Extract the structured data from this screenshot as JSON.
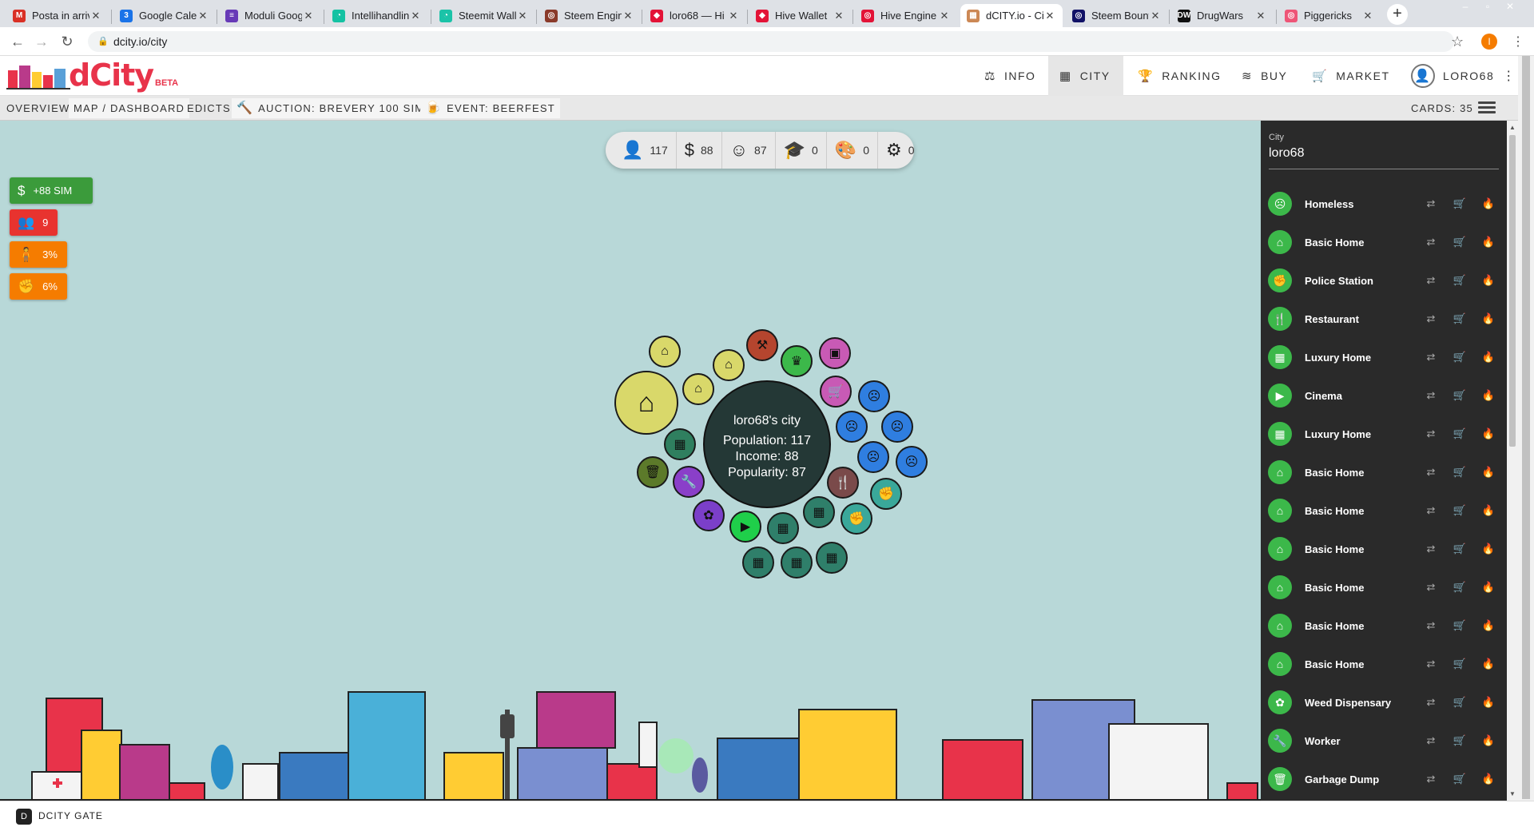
{
  "browser": {
    "tabs": [
      {
        "title": "Posta in arriv",
        "icon": "gmail-icon",
        "fav": "M",
        "color": "#d93025"
      },
      {
        "title": "Google Calen",
        "icon": "calendar-icon",
        "fav": "3",
        "color": "#1a73e8"
      },
      {
        "title": "Moduli Goog",
        "icon": "forms-icon",
        "fav": "≡",
        "color": "#673ab7"
      },
      {
        "title": "Intellihandlin",
        "icon": "intellihandling-icon",
        "fav": "◔",
        "color": "#14c2a3"
      },
      {
        "title": "Steemit Wall",
        "icon": "steemit-icon",
        "fav": "◔",
        "color": "#1bc3a8"
      },
      {
        "title": "Steem Engin",
        "icon": "steem-engine-icon",
        "fav": "◎",
        "color": "#8a3a2a"
      },
      {
        "title": "loro68 — Hi",
        "icon": "hive-icon",
        "fav": "◆",
        "color": "#e31337"
      },
      {
        "title": "Hive Wallet",
        "icon": "hive-wallet-icon",
        "fav": "◆",
        "color": "#e31337"
      },
      {
        "title": "Hive Engine",
        "icon": "hive-engine-icon",
        "fav": "◎",
        "color": "#e31337"
      },
      {
        "title": "dCITY.io - Ci",
        "icon": "dcity-icon",
        "fav": "▦",
        "color": "#c85"
      },
      {
        "title": "Steem Bount",
        "icon": "steem-bounty-icon",
        "fav": "◎",
        "color": "#116"
      },
      {
        "title": "DrugWars",
        "icon": "drugwars-icon",
        "fav": "DW",
        "color": "#111"
      },
      {
        "title": "Piggericks",
        "icon": "piggericks-icon",
        "fav": "◎",
        "color": "#e57"
      }
    ],
    "active_tab": 9,
    "url": "dcity.io/city",
    "profile_initial": "I"
  },
  "header": {
    "nav": [
      {
        "label": "INFO",
        "icon": "balance-scale-icon",
        "glyph": "⚖"
      },
      {
        "label": "CITY",
        "icon": "city-icon",
        "glyph": "▦"
      },
      {
        "label": "RANKING",
        "icon": "trophy-icon",
        "glyph": "🏆"
      },
      {
        "label": "BUY",
        "icon": "layers-icon",
        "glyph": "≋"
      },
      {
        "label": "MARKET",
        "icon": "cart-icon",
        "glyph": "🛒"
      }
    ],
    "active_nav": 1,
    "user": "LORO68",
    "logo_text": "dCity",
    "beta": "BETA"
  },
  "subnav": {
    "items": [
      "OVERVIEW",
      "MAP / DASHBOARD",
      "EDICTS"
    ],
    "auction": "AUCTION: BREVERY 100 SIM",
    "event": "EVENT: BEERFEST",
    "cards": "CARDS: 35"
  },
  "stats": [
    {
      "icon": "person-icon",
      "glyph": "👤",
      "value": "117"
    },
    {
      "icon": "dollar-icon",
      "glyph": "$",
      "value": "88"
    },
    {
      "icon": "smile-icon",
      "glyph": "☺",
      "value": "87"
    },
    {
      "icon": "graduation-cap-icon",
      "glyph": "🎓",
      "value": "0"
    },
    {
      "icon": "palette-icon",
      "glyph": "🎨",
      "value": "0"
    },
    {
      "icon": "gear-icon",
      "glyph": "⚙",
      "value": "0"
    }
  ],
  "badges": [
    {
      "label": "+88 SIM",
      "icon": "dollar-icon",
      "glyph": "$",
      "color": "#3b9b3b"
    },
    {
      "label": "9",
      "icon": "users-icon",
      "glyph": "👥",
      "color": "#e8332f"
    },
    {
      "label": "3%",
      "icon": "crowd-icon",
      "glyph": "🧍",
      "color": "#f57c00"
    },
    {
      "label": "6%",
      "icon": "fist-icon",
      "glyph": "✊",
      "color": "#f57c00"
    }
  ],
  "city_center": {
    "title": "loro68's city",
    "population": "Population: 117",
    "income": "Income: 88",
    "popularity": "Popularity: 87"
  },
  "panel": {
    "city_label": "City",
    "city_name": "loro68",
    "cards": [
      {
        "name": "Homeless",
        "icon": "homeless-icon",
        "glyph": "☹"
      },
      {
        "name": "Basic Home",
        "icon": "home-icon",
        "glyph": "⌂"
      },
      {
        "name": "Police Station",
        "icon": "fist-icon",
        "glyph": "✊"
      },
      {
        "name": "Restaurant",
        "icon": "utensils-icon",
        "glyph": "🍴"
      },
      {
        "name": "Luxury Home",
        "icon": "building-icon",
        "glyph": "▦"
      },
      {
        "name": "Cinema",
        "icon": "video-icon",
        "glyph": "▶"
      },
      {
        "name": "Luxury Home",
        "icon": "building-icon",
        "glyph": "▦"
      },
      {
        "name": "Basic Home",
        "icon": "home-icon",
        "glyph": "⌂"
      },
      {
        "name": "Basic Home",
        "icon": "home-icon",
        "glyph": "⌂"
      },
      {
        "name": "Basic Home",
        "icon": "home-icon",
        "glyph": "⌂"
      },
      {
        "name": "Basic Home",
        "icon": "home-icon",
        "glyph": "⌂"
      },
      {
        "name": "Basic Home",
        "icon": "home-icon",
        "glyph": "⌂"
      },
      {
        "name": "Basic Home",
        "icon": "home-icon",
        "glyph": "⌂"
      },
      {
        "name": "Weed Dispensary",
        "icon": "cannabis-icon",
        "glyph": "✿"
      },
      {
        "name": "Worker",
        "icon": "wrench-icon",
        "glyph": "🔧"
      },
      {
        "name": "Garbage Dump",
        "icon": "trash-icon",
        "glyph": "🗑"
      }
    ],
    "card_actions": [
      "transfer-icon",
      "cart-icon",
      "burn-icon"
    ]
  },
  "map_bubbles": [
    {
      "icon": "home-icon",
      "glyph": "⌂",
      "color": "#d9d86a"
    },
    {
      "icon": "home-icon",
      "glyph": "⌂",
      "color": "#d9d86a"
    },
    {
      "icon": "home-icon",
      "glyph": "⌂",
      "color": "#d9d86a"
    },
    {
      "icon": "home-icon",
      "glyph": "⌂",
      "color": "#d9d86a"
    },
    {
      "icon": "dumbbell-icon",
      "glyph": "⚒",
      "color": "#b5452e"
    },
    {
      "icon": "crown-icon",
      "glyph": "♛",
      "color": "#3cb84a"
    },
    {
      "icon": "shop-icon",
      "glyph": "▣",
      "color": "#c85ab5"
    },
    {
      "icon": "cart-icon",
      "glyph": "🛒",
      "color": "#c85ab5"
    },
    {
      "icon": "sad-icon",
      "glyph": "☹",
      "color": "#2f7ee0"
    },
    {
      "icon": "sad-icon",
      "glyph": "☹",
      "color": "#2f7ee0"
    },
    {
      "icon": "sad-icon",
      "glyph": "☹",
      "color": "#2f7ee0"
    },
    {
      "icon": "sad-icon",
      "glyph": "☹",
      "color": "#2f7ee0"
    },
    {
      "icon": "sad-icon",
      "glyph": "☹",
      "color": "#2f7ee0"
    },
    {
      "icon": "building-icon",
      "glyph": "▦",
      "color": "#2f7f5f"
    },
    {
      "icon": "trash-icon",
      "glyph": "🗑",
      "color": "#5c7a2a"
    },
    {
      "icon": "wrench-icon",
      "glyph": "🔧",
      "color": "#8a3fc9"
    },
    {
      "icon": "cannabis-icon",
      "glyph": "✿",
      "color": "#7b3fc9"
    },
    {
      "icon": "video-icon",
      "glyph": "▶",
      "color": "#1fcf4a"
    },
    {
      "icon": "building-icon",
      "glyph": "▦",
      "color": "#2f7f6a"
    },
    {
      "icon": "building-icon",
      "glyph": "▦",
      "color": "#2f7f6a"
    },
    {
      "icon": "building-icon",
      "glyph": "▦",
      "color": "#2f7f6a"
    },
    {
      "icon": "building-icon",
      "glyph": "▦",
      "color": "#2f7f6a"
    },
    {
      "icon": "building-icon",
      "glyph": "▦",
      "color": "#2f7f6a"
    },
    {
      "icon": "utensils-icon",
      "glyph": "🍴",
      "color": "#7a4a4a"
    },
    {
      "icon": "fist-icon",
      "glyph": "✊",
      "color": "#3aa89a"
    },
    {
      "icon": "fist-icon",
      "glyph": "✊",
      "color": "#3aa89a"
    }
  ],
  "footer": {
    "label": "DCITY GATE"
  },
  "colors": {
    "map_bg": "#b8d8d8",
    "panel_bg": "#2a2a2a",
    "card_green": "#3cb84a"
  }
}
